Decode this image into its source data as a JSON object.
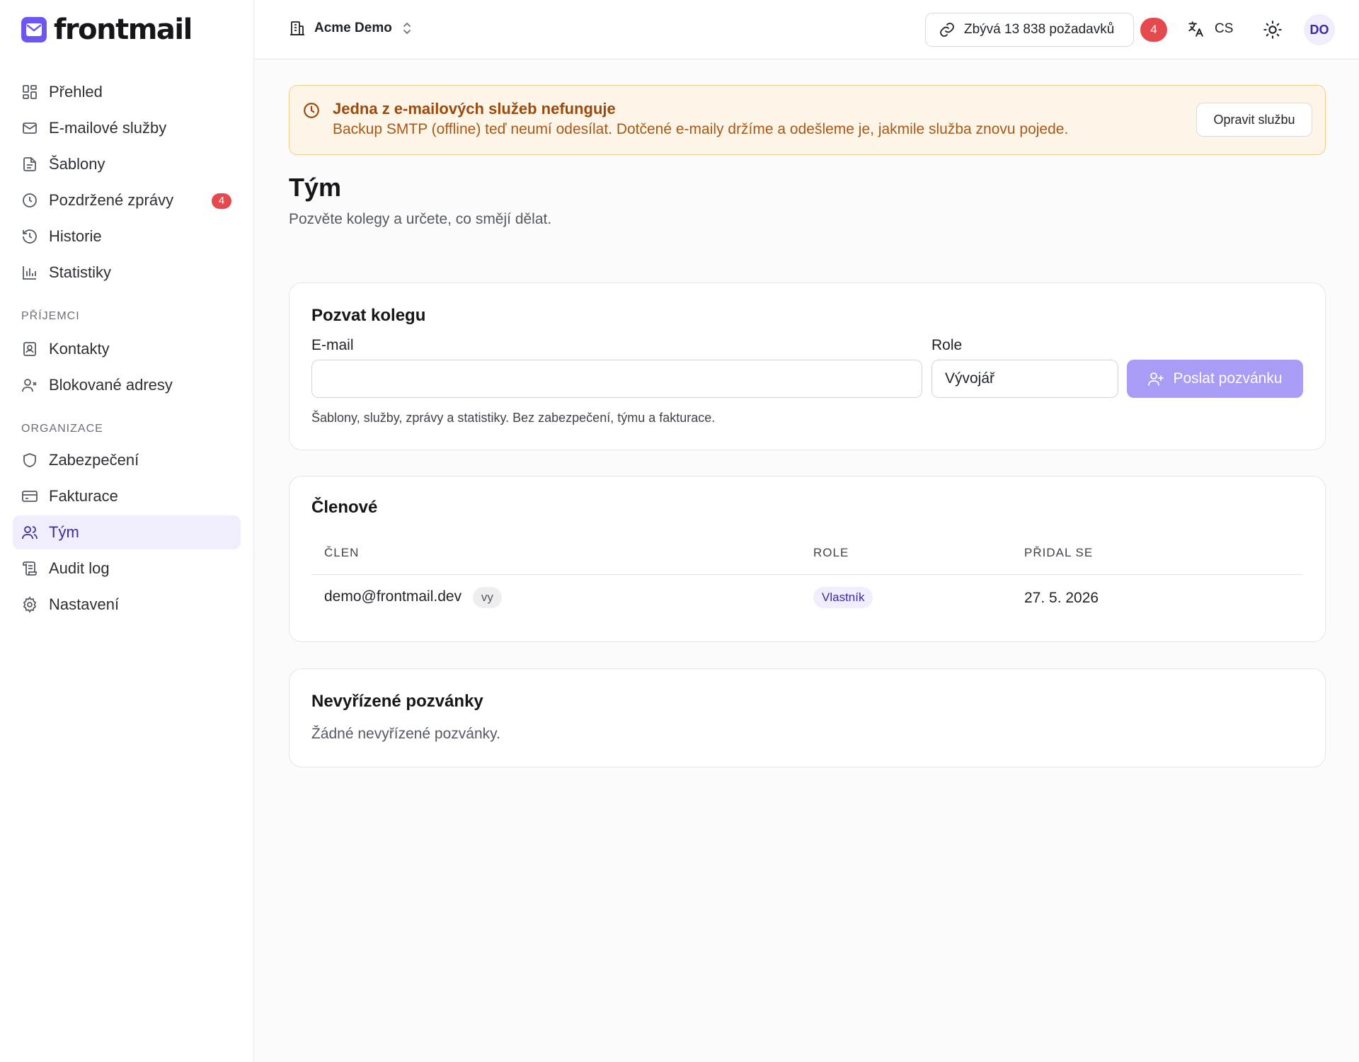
{
  "app": {
    "name": "frontmail"
  },
  "sidebar": {
    "items": [
      {
        "label": "Přehled",
        "icon": "dashboard-icon"
      },
      {
        "label": "E-mailové služby",
        "icon": "mail-icon"
      },
      {
        "label": "Šablony",
        "icon": "file-text-icon"
      },
      {
        "label": "Pozdržené zprávy",
        "icon": "clock-icon",
        "badge": "4"
      },
      {
        "label": "Historie",
        "icon": "history-icon"
      },
      {
        "label": "Statistiky",
        "icon": "bar-chart-icon"
      }
    ],
    "section_recipients": "PŘÍJEMCI",
    "recipients": [
      {
        "label": "Kontakty",
        "icon": "contact-card-icon"
      },
      {
        "label": "Blokované adresy",
        "icon": "user-x-icon"
      }
    ],
    "section_org": "ORGANIZACE",
    "org": [
      {
        "label": "Zabezpečení",
        "icon": "shield-icon"
      },
      {
        "label": "Fakturace",
        "icon": "credit-card-icon"
      },
      {
        "label": "Tým",
        "icon": "users-icon",
        "active": true
      },
      {
        "label": "Audit log",
        "icon": "scroll-icon"
      },
      {
        "label": "Nastavení",
        "icon": "gear-icon"
      }
    ]
  },
  "topbar": {
    "org_name": "Acme Demo",
    "quota": "Zbývá 13 838 požadavků",
    "notifications": "4",
    "lang": "CS",
    "avatar": "DO"
  },
  "alert": {
    "title": "Jedna z e-mailových služeb nefunguje",
    "text": "Backup SMTP (offline) teď neumí odesílat. Dotčené e-maily držíme a odešleme je, jakmile služba znovu pojede.",
    "button": "Opravit službu"
  },
  "page": {
    "title": "Tým",
    "subtitle": "Pozvěte kolegy a určete, co smějí dělat."
  },
  "invite": {
    "title": "Pozvat kolegu",
    "email_label": "E-mail",
    "email_value": "",
    "role_label": "Role",
    "role_value": "Vývojář",
    "send_button": "Poslat pozvánku",
    "hint": "Šablony, služby, zprávy a statistiky. Bez zabezpečení, týmu a fakturace."
  },
  "members": {
    "title": "Členové",
    "columns": [
      "ČLEN",
      "ROLE",
      "PŘIDAL SE"
    ],
    "rows": [
      {
        "email": "demo@frontmail.dev",
        "you": "vy",
        "role": "Vlastník",
        "joined": "27. 5. 2026"
      }
    ]
  },
  "pending": {
    "title": "Nevyřízené pozvánky",
    "empty": "Žádné nevyřízené pozvánky."
  },
  "colors": {
    "accent": "#6b56f5",
    "accent_light": "#a99cf6",
    "badge_red": "#e5484d",
    "alert_bg": "#fdf5e7",
    "alert_text": "#9a4a0c"
  }
}
